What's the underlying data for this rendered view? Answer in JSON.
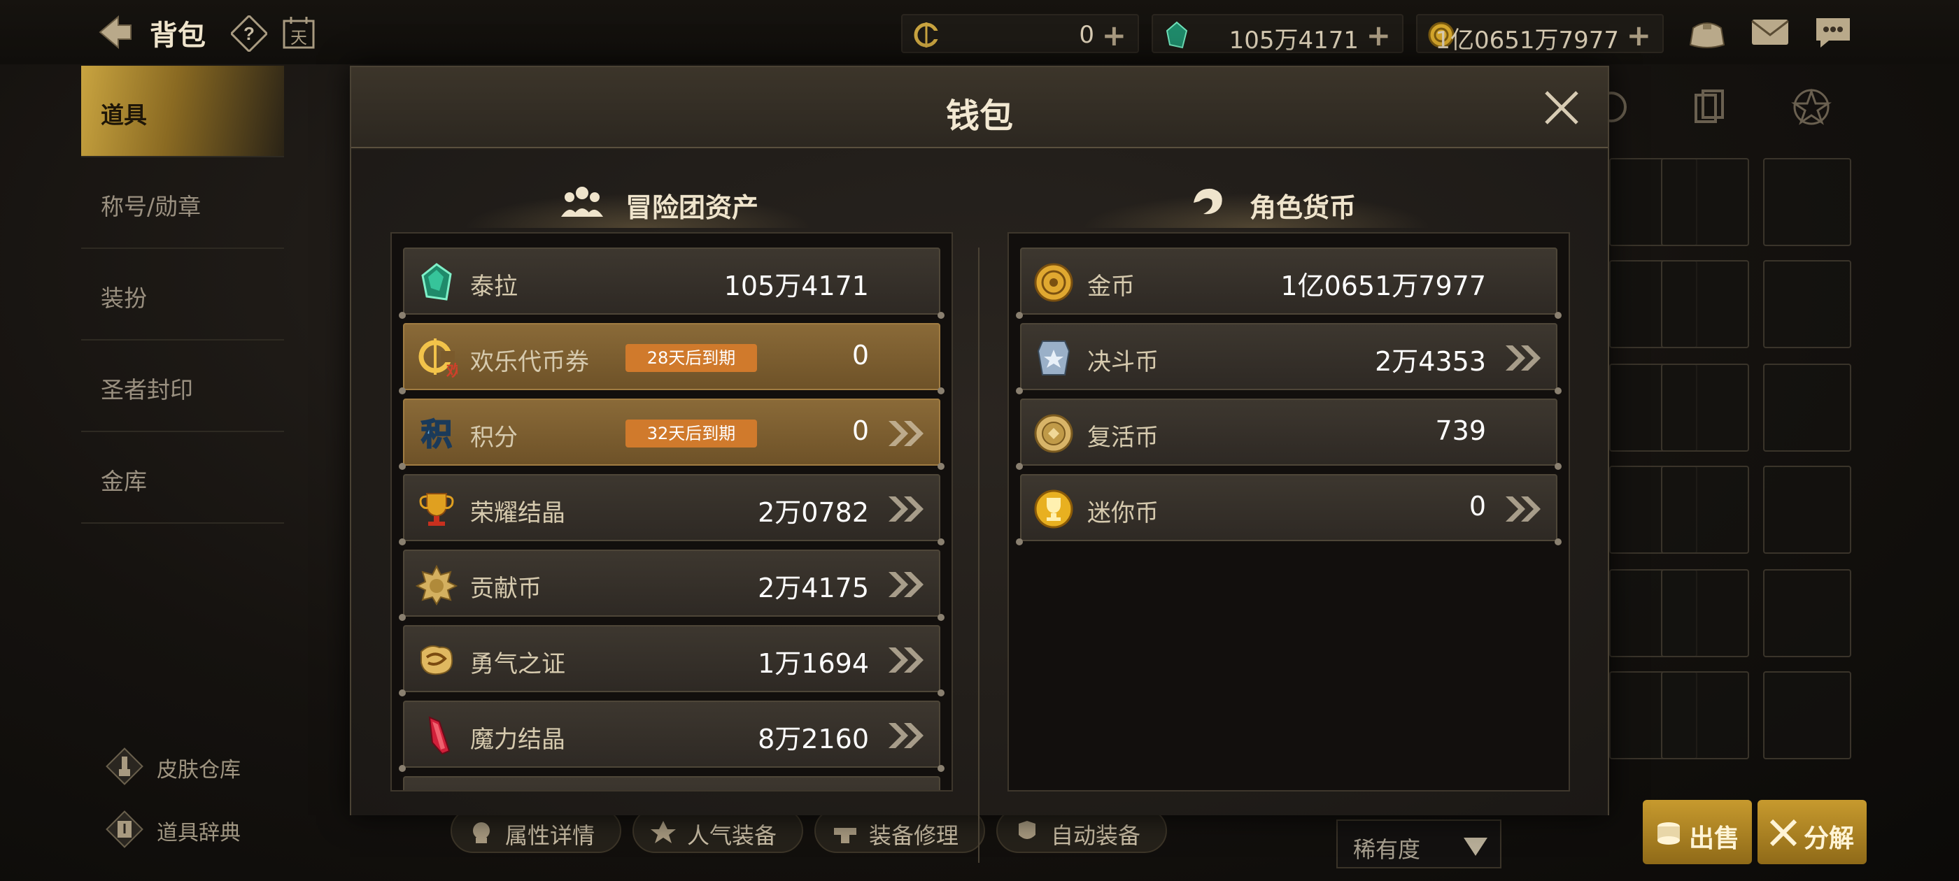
{
  "topbar": {
    "title": "背包",
    "calendar_char": "天",
    "currencies": [
      {
        "icon": "joy-token-icon",
        "value": "0"
      },
      {
        "icon": "tera-gem-icon",
        "value": "105万4171"
      },
      {
        "icon": "gold-coin-icon",
        "value": "1亿0651万7977"
      }
    ]
  },
  "sidebar": {
    "items": [
      {
        "label": "道具",
        "active": true
      },
      {
        "label": "称号/勋章",
        "active": false
      },
      {
        "label": "装扮",
        "active": false
      },
      {
        "label": "圣者封印",
        "active": false
      },
      {
        "label": "金库",
        "active": false
      }
    ],
    "bottom_links": [
      {
        "label": "皮肤仓库",
        "icon": "brush-icon"
      },
      {
        "label": "道具辞典",
        "icon": "dictionary-icon"
      }
    ]
  },
  "bottom_bar": {
    "buttons": [
      "属性详情",
      "人气装备",
      "装备修理",
      "自动装备"
    ],
    "rarity_select": "稀有度",
    "sell_label": "出售",
    "disassemble_label": "分解"
  },
  "modal": {
    "title": "钱包",
    "left_section": {
      "title": "冒险团资产",
      "rows": [
        {
          "name": "泰拉",
          "value": "105万4171",
          "badge": "",
          "style": "normal",
          "chevron": false,
          "icon": "tera-gem-icon"
        },
        {
          "name": "欢乐代币券",
          "value": "0",
          "badge": "28天后到期",
          "style": "gold",
          "chevron": false,
          "icon": "joy-token-icon"
        },
        {
          "name": "积分",
          "value": "0",
          "badge": "32天后到期",
          "style": "gold",
          "chevron": true,
          "icon": "points-icon"
        },
        {
          "name": "荣耀结晶",
          "value": "2万0782",
          "badge": "",
          "style": "normal",
          "chevron": true,
          "icon": "trophy-icon"
        },
        {
          "name": "贡献币",
          "value": "2万4175",
          "badge": "",
          "style": "normal",
          "chevron": true,
          "icon": "contribution-coin-icon"
        },
        {
          "name": "勇气之证",
          "value": "1万1694",
          "badge": "",
          "style": "normal",
          "chevron": true,
          "icon": "courage-badge-icon"
        },
        {
          "name": "魔力结晶",
          "value": "8万2160",
          "badge": "",
          "style": "normal",
          "chevron": true,
          "icon": "mana-crystal-icon"
        }
      ]
    },
    "right_section": {
      "title": "角色货币",
      "rows": [
        {
          "name": "金币",
          "value": "1亿0651万7977",
          "chevron": false,
          "icon": "gold-coin-icon"
        },
        {
          "name": "决斗币",
          "value": "2万4353",
          "chevron": true,
          "icon": "duel-coin-icon"
        },
        {
          "name": "复活币",
          "value": "739",
          "chevron": false,
          "icon": "revive-coin-icon"
        },
        {
          "name": "迷你币",
          "value": "0",
          "chevron": true,
          "icon": "mini-coin-icon"
        }
      ]
    }
  },
  "colors": {
    "accent_gold": "#c9a440",
    "badge_orange": "#d07a2c",
    "panel_bg": "#231f1a"
  }
}
